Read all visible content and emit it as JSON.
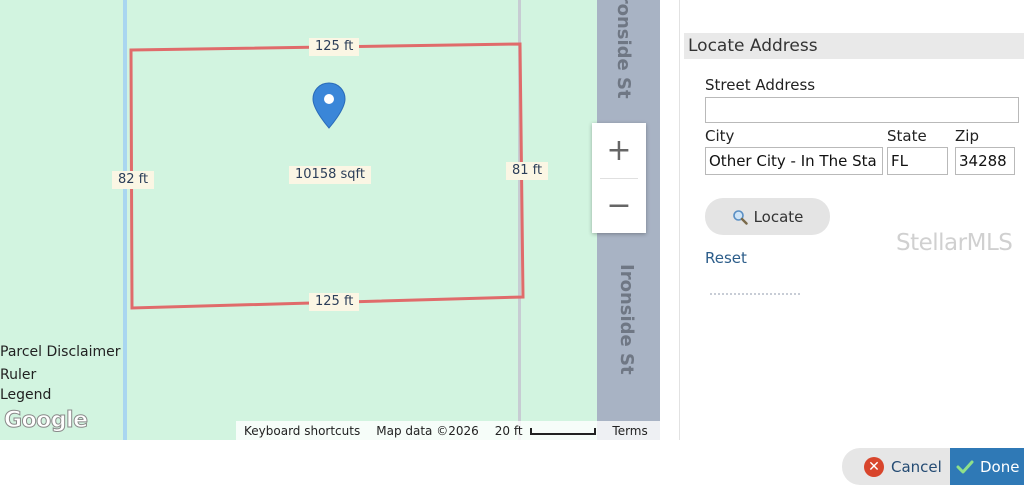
{
  "map": {
    "dimensions": {
      "top": "125 ft",
      "bottom": "125 ft",
      "left": "82 ft",
      "right": "81 ft",
      "area": "10158 sqft"
    },
    "streets": {
      "top": "Ironside St",
      "bottom": "Ironside St"
    },
    "zoom": {
      "in_symbol": "+",
      "out_symbol": "−"
    },
    "links": {
      "parcel_disclaimer": "Parcel Disclaimer",
      "ruler": "Ruler",
      "legend": "Legend"
    },
    "logo": "Google",
    "attribution": {
      "keyboard_shortcuts": "Keyboard shortcuts",
      "map_data": "Map data ©2026",
      "scale": "20 ft",
      "terms": "Terms"
    },
    "colors": {
      "background": "#d2f4e0",
      "parcel_outline": "#e06b6b",
      "road": "#a8b3c4",
      "pin": "#3a86d8"
    }
  },
  "panel": {
    "title": "Locate Address",
    "street_address": {
      "label": "Street Address",
      "value": ""
    },
    "city": {
      "label": "City",
      "value": "Other City - In The Sta"
    },
    "state": {
      "label": "State",
      "value": "FL"
    },
    "zip": {
      "label": "Zip",
      "value": "34288"
    },
    "locate_button": "Locate",
    "reset_link": "Reset",
    "watermark": "StellarMLS"
  },
  "footer": {
    "cancel": "Cancel",
    "done": "Done",
    "icons": {
      "cancel": "cancel-x-icon",
      "done": "checkmark-icon",
      "locate": "magnifier-icon",
      "pin": "map-pin-icon"
    }
  }
}
